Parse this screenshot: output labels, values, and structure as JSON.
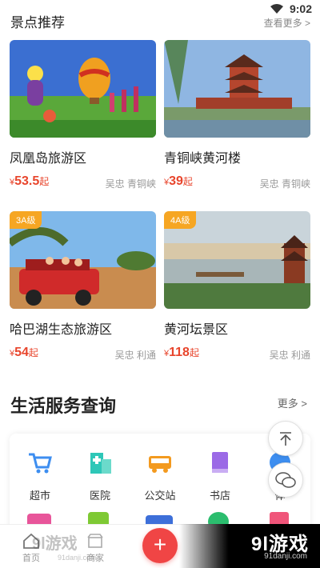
{
  "status": {
    "time": "9:02"
  },
  "scenic": {
    "title": "景点推荐",
    "more": "查看更多 >",
    "items": [
      {
        "name": "凤凰岛旅游区",
        "price": "53.5",
        "suffix": "起",
        "currency": "¥",
        "location": "吴忠 青铜峡",
        "badge": ""
      },
      {
        "name": "青铜峡黄河楼",
        "price": "39",
        "suffix": "起",
        "currency": "¥",
        "location": "吴忠 青铜峡",
        "badge": ""
      },
      {
        "name": "哈巴湖生态旅游区",
        "price": "54",
        "suffix": "起",
        "currency": "¥",
        "location": "吴忠 利通",
        "badge": "3A级"
      },
      {
        "name": "黄河坛景区",
        "price": "118",
        "suffix": "起",
        "currency": "¥",
        "location": "吴忠 利通",
        "badge": "4A级"
      }
    ]
  },
  "life": {
    "title": "生活服务查询",
    "more": "更多 >",
    "services": [
      {
        "label": "超市",
        "icon": "cart-icon"
      },
      {
        "label": "医院",
        "icon": "hospital-icon"
      },
      {
        "label": "公交站",
        "icon": "bus-icon"
      },
      {
        "label": "书店",
        "icon": "book-icon"
      },
      {
        "label": "体",
        "icon": "ball-icon"
      }
    ]
  },
  "nav": {
    "home": "首页",
    "merchant": "商家",
    "fab": "+"
  },
  "watermark": {
    "main": "9l游戏",
    "sub": "91danji.com",
    "left_main": "9l游戏",
    "left_sub": "91danji.com"
  },
  "colors": {
    "price": "#e8452c",
    "badge": "#f6a623",
    "fab": "#f04545",
    "accent_underline": "#ffd34d"
  }
}
